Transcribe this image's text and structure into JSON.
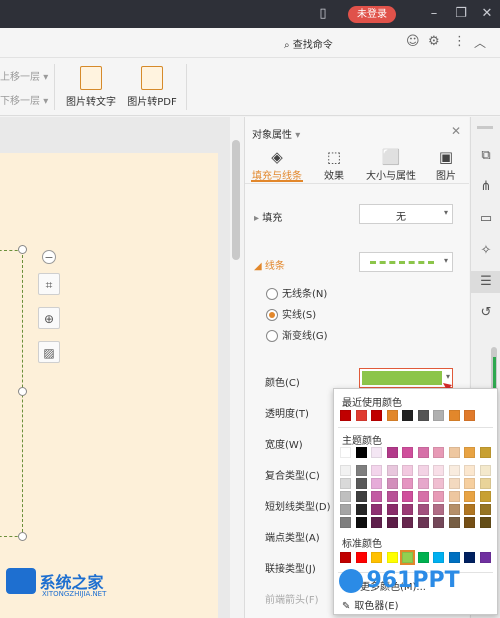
{
  "titlebar": {
    "login_label": "未登录",
    "icons": [
      "window-mode-icon",
      "minimize-icon",
      "restore-icon",
      "close-icon"
    ]
  },
  "tabbar": {
    "search_label": "查找命令",
    "icons": [
      "search-icon",
      "emoji-icon",
      "settings-icon",
      "more-icon",
      "collapse-icon"
    ]
  },
  "ribbon": {
    "move_up": "上移一层",
    "move_down": "下移一层",
    "img_to_text": "图片转文字",
    "img_to_pdf": "图片转PDF"
  },
  "panel": {
    "title": "对象属性",
    "tabs": [
      {
        "label": "填充与线条",
        "icon": "fill-bucket-icon",
        "active": true
      },
      {
        "label": "效果",
        "icon": "effects-icon",
        "active": false
      },
      {
        "label": "大小与属性",
        "icon": "size-icon",
        "active": false
      },
      {
        "label": "图片",
        "icon": "picture-icon",
        "active": false
      }
    ],
    "fill": {
      "label": "填充",
      "value": "无"
    },
    "line": {
      "label": "线条"
    },
    "line_options": [
      {
        "label": "无线条(N)",
        "checked": false
      },
      {
        "label": "实线(S)",
        "checked": true
      },
      {
        "label": "渐变线(G)",
        "checked": false
      }
    ],
    "props": [
      {
        "label": "颜色(C)"
      },
      {
        "label": "透明度(T)"
      },
      {
        "label": "宽度(W)"
      },
      {
        "label": "复合类型(C)"
      },
      {
        "label": "短划线类型(D)"
      },
      {
        "label": "端点类型(A)"
      },
      {
        "label": "联接类型(J)"
      },
      {
        "label": "前端箭头(F)"
      }
    ],
    "line_color": "#8cc54a"
  },
  "popup": {
    "recent_title": "最近使用颜色",
    "theme_title": "主题颜色",
    "standard_title": "标准颜色",
    "more_colors": "更多颜色(M)...",
    "picker": "取色器(E)",
    "recent_colors": [
      "#c00000",
      "#e03c31",
      "#c00000",
      "#e2872b",
      "#222222",
      "#555555",
      "#b0b0b0",
      "#e2872b",
      "#e07a2b"
    ],
    "theme_row": [
      "#ffffff",
      "#000000",
      "#f4e6f4",
      "#b23a8a",
      "#cf4f9c",
      "#d670a8",
      "#e79ab6",
      "#eec7a0",
      "#e8a343",
      "#c8a032"
    ],
    "tint_columns": [
      [
        "#f2f2f2",
        "#d9d9d9",
        "#bfbfbf",
        "#a5a5a5",
        "#7f7f7f"
      ],
      [
        "#7f7f7f",
        "#595959",
        "#3f3f3f",
        "#262626",
        "#0d0d0d"
      ],
      [
        "#f3d5ec",
        "#e6acd9",
        "#c25ba3",
        "#8f2f72",
        "#5f1f4c"
      ],
      [
        "#e8c7dd",
        "#d28fbb",
        "#b85296",
        "#8a2c6a",
        "#5c1d47"
      ],
      [
        "#f2c9e0",
        "#e594c1",
        "#cf4f9c",
        "#9b3a75",
        "#67274e"
      ],
      [
        "#f3d3e5",
        "#e6a7cb",
        "#d670a8",
        "#a2507e",
        "#6b3554"
      ],
      [
        "#f8dfe8",
        "#f0bed1",
        "#e79ab6",
        "#b06c85",
        "#744859"
      ],
      [
        "#f9ecdf",
        "#f3d9bf",
        "#eec7a0",
        "#b58f68",
        "#775e44"
      ],
      [
        "#fbe7cf",
        "#f6cf9f",
        "#e8a343",
        "#b07622",
        "#754f16"
      ],
      [
        "#f4e9cc",
        "#e9d399",
        "#c8a032",
        "#967524",
        "#644e18"
      ]
    ],
    "standard_colors": [
      "#c00000",
      "#ff0000",
      "#ffc000",
      "#ffff00",
      "#92d050",
      "#00b050",
      "#00b0f0",
      "#0070c0",
      "#002060",
      "#7030a0"
    ],
    "standard_selected": 4
  },
  "watermarks": {
    "left_title": "系统之家",
    "left_sub": "XITONGZHIJIA.NET",
    "right_title": "961PPT"
  }
}
